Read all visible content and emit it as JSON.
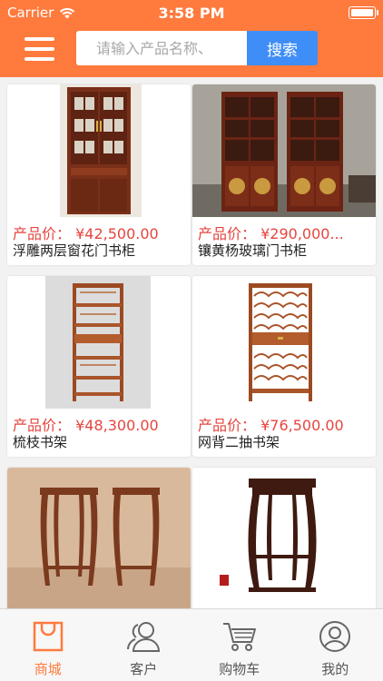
{
  "status": {
    "carrier": "Carrier",
    "time": "3:58 PM"
  },
  "header": {
    "search_placeholder": "请输入产品名称、",
    "search_button": "搜索"
  },
  "price_prefix": "产品价：",
  "products": [
    {
      "price": "¥42,500.00",
      "name": "浮雕两层窗花门书柜"
    },
    {
      "price": "¥290,000...",
      "name": "镶黄杨玻璃门书柜"
    },
    {
      "price": "¥48,300.00",
      "name": "梳枝书架"
    },
    {
      "price": "¥76,500.00",
      "name": "网背二抽书架"
    }
  ],
  "tabs": [
    {
      "label": "商城",
      "icon": "shop-bag-icon",
      "active": true
    },
    {
      "label": "客户",
      "icon": "users-icon",
      "active": false
    },
    {
      "label": "购物车",
      "icon": "cart-icon",
      "active": false
    },
    {
      "label": "我的",
      "icon": "profile-icon",
      "active": false
    }
  ],
  "colors": {
    "accent": "#ff7a3d",
    "price": "#e6453f",
    "button": "#3f8ef7",
    "wood": "#8a3a1e"
  }
}
